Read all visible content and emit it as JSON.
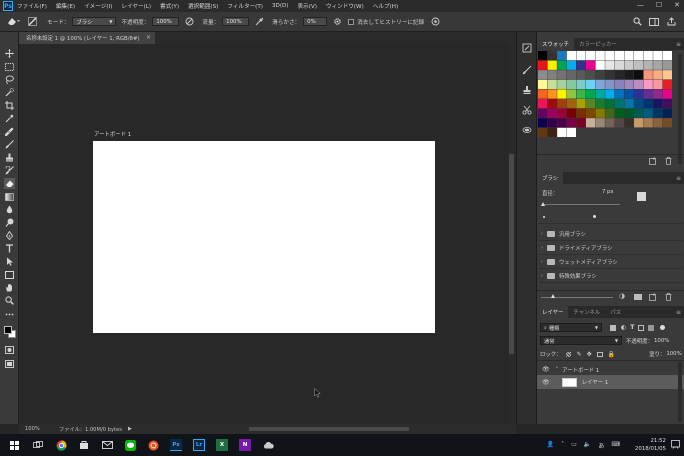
{
  "menubar": {
    "logo": "Ps",
    "items": [
      "ファイル(F)",
      "編集(E)",
      "イメージ(I)",
      "レイヤー(L)",
      "書式(Y)",
      "選択範囲(S)",
      "フィルター(T)",
      "3D(D)",
      "表示(V)",
      "ウィンドウ(W)",
      "ヘルプ(H)"
    ],
    "window_controls": [
      "—",
      "☐",
      "✕"
    ]
  },
  "options": {
    "mode_label": "モード：",
    "mode_value": "ブラシ",
    "opacity_label": "不透明度：",
    "opacity_value": "100%",
    "flow_label": "流量：",
    "flow_value": "100%",
    "smoothing_label": "滑らかさ：",
    "smoothing_value": "0%",
    "history_label": "消去してヒストリーに記録"
  },
  "document": {
    "tab_title": "名称未設定 1 @ 100% (レイヤー 1, RGB/8#)",
    "tab_close": "×",
    "artboard_label": "アートボード 1"
  },
  "status": {
    "zoom": "100%",
    "file_info": "ファイル：1.00M/0 bytes"
  },
  "swatches_panel": {
    "tabs": [
      "スウォッチ",
      "カラーピッカー"
    ],
    "colors": [
      "#000000",
      "#333333",
      "#1a7ac4",
      "#ffffff",
      "#ffffff",
      "#ffffff",
      "#ffffff",
      "#ffffff",
      "#ffffff",
      "#ffffff",
      "#ffffff",
      "#ffffff",
      "#ffffff",
      "#ffffff",
      "#e6151b",
      "#fff200",
      "#00a651",
      "#00aeef",
      "#2e3192",
      "#ec008c",
      "#ffffff",
      "#e6e6e6",
      "#d9d9d9",
      "#cccccc",
      "#bfbfbf",
      "#b3b3b3",
      "#a6a6a6",
      "#999999",
      "#8c8c8c",
      "#808080",
      "#737373",
      "#666666",
      "#595959",
      "#4d4d4d",
      "#404040",
      "#333333",
      "#262626",
      "#1a1a1a",
      "#0d0d0d",
      "#f7977a",
      "#f9ad81",
      "#fdc68a",
      "#fff79a",
      "#c4df9b",
      "#a3d39c",
      "#82ca9d",
      "#7bcdc8",
      "#6ecff6",
      "#7ea7d8",
      "#8493ca",
      "#8882be",
      "#a187be",
      "#bc8dbf",
      "#f49ac2",
      "#f6989d",
      "#ed1c24",
      "#f26522",
      "#f7941d",
      "#fff200",
      "#8dc63f",
      "#39b54a",
      "#00a651",
      "#00a99d",
      "#00aeef",
      "#0072bc",
      "#0054a6",
      "#2e3192",
      "#662d91",
      "#92278f",
      "#ec008c",
      "#ed145b",
      "#9e0b0f",
      "#a0410d",
      "#a36209",
      "#aba000",
      "#598527",
      "#1a7b30",
      "#007236",
      "#00746b",
      "#0076a3",
      "#004a80",
      "#003471",
      "#1b1464",
      "#440e62",
      "#630460",
      "#9e005d",
      "#9e0039",
      "#790000",
      "#7b2e00",
      "#7d4900",
      "#827b00",
      "#406618",
      "#005e20",
      "#005826",
      "#005952",
      "#005b7f",
      "#003663",
      "#002157",
      "#0d004c",
      "#32004b",
      "#4b0049",
      "#7b0046",
      "#7a0026",
      "#c7b299",
      "#998675",
      "#736357",
      "#534741",
      "#37302d",
      "#c69c6d",
      "#a67c52",
      "#8c6239",
      "#754c24",
      "#603913",
      "#3c2415",
      "#ffffff",
      "#ffffff"
    ]
  },
  "brushes_panel": {
    "tab": "ブラシ",
    "size_label": "直径：",
    "size_value": "7 px",
    "folders": [
      "汎用ブラシ",
      "ドライメディアブラシ",
      "ウェットメディアブラシ",
      "特殊効果ブラシ"
    ]
  },
  "layers_panel": {
    "tabs": [
      "レイヤー",
      "チャンネル",
      "パス"
    ],
    "filter_value": "種類",
    "blend_mode": "通常",
    "opacity_label": "不透明度：",
    "opacity_value": "100%",
    "lock_label": "ロック：",
    "fill_label": "塗り：",
    "fill_value": "100%",
    "artboard_name": "アートボード 1",
    "layer_name": "レイヤー 1"
  },
  "taskbar": {
    "time": "21:52",
    "date": "2018/01/05",
    "ime": "あ",
    "apps": [
      "Ps",
      "Lr",
      "X",
      "N"
    ]
  }
}
